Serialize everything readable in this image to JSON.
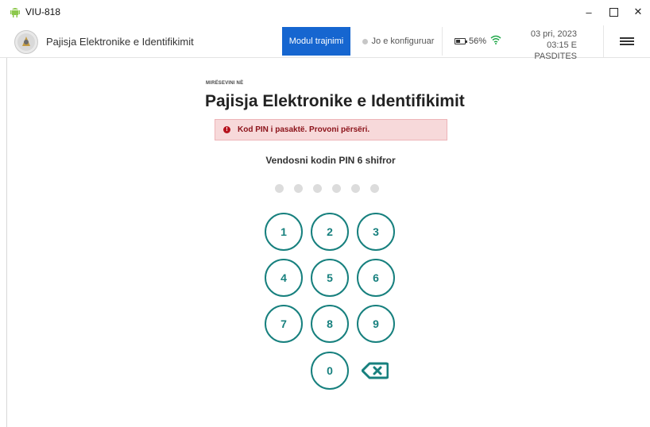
{
  "window": {
    "title": "VIU-818"
  },
  "header": {
    "app_name": "Pajisja Elektronike e Identifikimit",
    "mode_button": "Modul trajnimi",
    "config_status": "Jo e konfiguruar",
    "battery": "56%",
    "date": "03 pri, 2023",
    "time": "03:15 E PASDITES"
  },
  "main": {
    "welcome": "MIRËSEVINI NË",
    "title": "Pajisja Elektronike e Identifikimit",
    "alert": "Kod PIN i pasaktë. Provoni përsëri.",
    "pin_prompt": "Vendosni kodin PIN 6 shifror",
    "keys": [
      "1",
      "2",
      "3",
      "4",
      "5",
      "6",
      "7",
      "8",
      "9",
      "0"
    ]
  },
  "colors": {
    "accent": "#1666d0",
    "keypad": "#17807e",
    "alert_bg": "#f7d9da",
    "alert_text": "#8b1219"
  },
  "icons": [
    "android-icon",
    "minimize-icon",
    "maximize-icon",
    "close-icon",
    "logo-icon",
    "battery-icon",
    "wifi-icon",
    "menu-icon",
    "alert-icon",
    "backspace-icon"
  ]
}
